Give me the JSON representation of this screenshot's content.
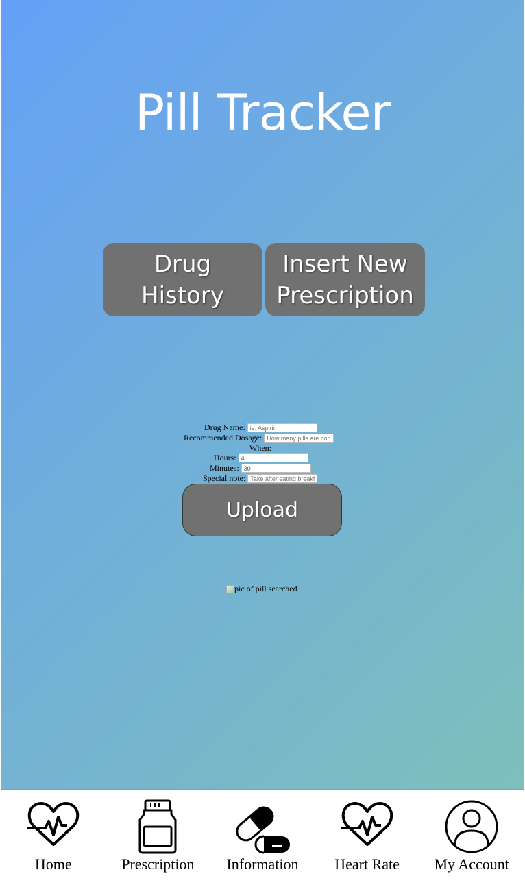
{
  "app": {
    "title": "Pill Tracker"
  },
  "buttons": {
    "drug_history": "Drug History",
    "insert_new": "Insert New Prescription",
    "upload": "Upload"
  },
  "form": {
    "drug_name": {
      "label": "Drug Name:",
      "placeholder": "ie: Aspirin"
    },
    "dosage": {
      "label": "Recommended Dosage:",
      "placeholder": "How many pills are cons"
    },
    "when": {
      "label": "When:"
    },
    "hours": {
      "label": "Hours:",
      "value": "4"
    },
    "minutes": {
      "label": "Minutes:",
      "value": "30"
    },
    "note": {
      "label": "Special note:",
      "placeholder": "Take after eating breakf"
    }
  },
  "pill_image": {
    "alt": "pic of pill searched"
  },
  "nav": [
    {
      "label": "Home",
      "icon": "heartbeat-icon"
    },
    {
      "label": "Prescription",
      "icon": "pill-bottle-icon"
    },
    {
      "label": "Information",
      "icon": "capsule-icon"
    },
    {
      "label": "Heart Rate",
      "icon": "heartbeat-icon"
    },
    {
      "label": "My Account",
      "icon": "user-icon"
    }
  ],
  "colors": {
    "button": "#717171",
    "gradient_start": "#66a0f7",
    "gradient_end": "#7dc0bb"
  }
}
